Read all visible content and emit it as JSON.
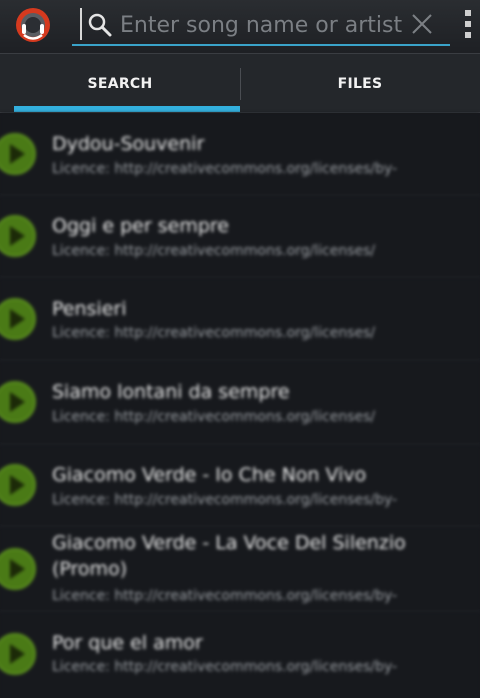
{
  "search": {
    "placeholder": "Enter song name or artist",
    "value": ""
  },
  "tabs": [
    {
      "label": "SEARCH",
      "active": true
    },
    {
      "label": "FILES",
      "active": false
    }
  ],
  "results": [
    {
      "title": "Dydou-Souvenir",
      "subtitle": "Licence: http://creativecommons.org/licenses/by-"
    },
    {
      "title": "Oggi e per sempre",
      "subtitle": "Licence: http://creativecommons.org/licenses/"
    },
    {
      "title": "Pensieri",
      "subtitle": "Licence: http://creativecommons.org/licenses/"
    },
    {
      "title": "Siamo lontani da sempre",
      "subtitle": "Licence: http://creativecommons.org/licenses/"
    },
    {
      "title": "Giacomo Verde - Io Che Non Vivo",
      "subtitle": "Licence: http://creativecommons.org/licenses/by-"
    },
    {
      "title": "Giacomo Verde - La Voce Del Silenzio (Promo)",
      "subtitle": "Licence: http://creativecommons.org/licenses/by-"
    },
    {
      "title": "Por que el amor",
      "subtitle": "Licence: http://creativecommons.org/licenses/by-"
    }
  ],
  "colors": {
    "accent": "#33b0de",
    "play_button": "#4a7a16",
    "background": "#17191d"
  },
  "icons": {
    "logo": "app-logo-icon",
    "search": "search-icon",
    "clear": "clear-icon",
    "overflow": "overflow-menu-icon",
    "play": "play-icon"
  }
}
